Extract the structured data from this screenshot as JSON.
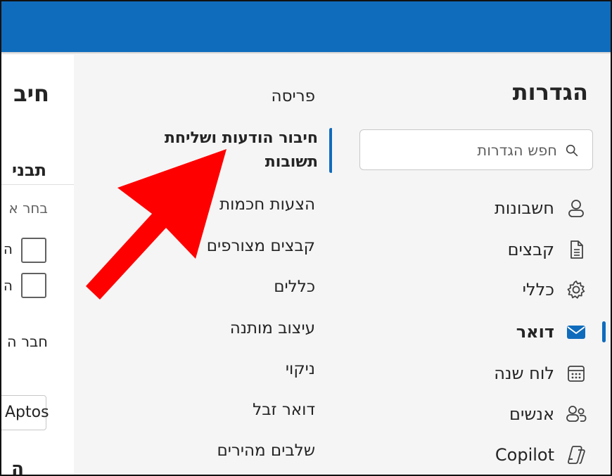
{
  "settings": {
    "title": "הגדרות",
    "search_placeholder": "חפש הגדרות",
    "nav": [
      {
        "label": "חשבונות",
        "icon": "person-icon",
        "active": false
      },
      {
        "label": "קבצים",
        "icon": "document-icon",
        "active": false
      },
      {
        "label": "כללי",
        "icon": "gear-icon",
        "active": false
      },
      {
        "label": "דואר",
        "icon": "mail-icon",
        "active": true
      },
      {
        "label": "לוח שנה",
        "icon": "calendar-icon",
        "active": false
      },
      {
        "label": "אנשים",
        "icon": "people-icon",
        "active": false
      },
      {
        "label": "Copilot",
        "icon": "copilot-icon",
        "active": false
      }
    ]
  },
  "mail_nav": {
    "items": [
      {
        "label": "פריסה"
      },
      {
        "label": "חיבור הודעות ושליחת תשובות",
        "active": true
      },
      {
        "label": "הצעות חכמות"
      },
      {
        "label": "קבצים מצורפים"
      },
      {
        "label": "כללים"
      },
      {
        "label": "עיצוב מותנה"
      },
      {
        "label": "ניקוי"
      },
      {
        "label": "דואר זבל"
      },
      {
        "label": "שלבים מהירים"
      }
    ]
  },
  "content": {
    "title_fragment": "חיב",
    "section_fragment": "תבני",
    "subtitle_fragment": "בחר א",
    "checkbox_label_1": "ה",
    "checkbox_label_2": "ה",
    "compose_fragment": "חבר ה",
    "font_value": "Aptos",
    "bottom_fragment": "ה"
  },
  "colors": {
    "accent": "#0f6cbd",
    "annotation_arrow": "#ff0000"
  }
}
